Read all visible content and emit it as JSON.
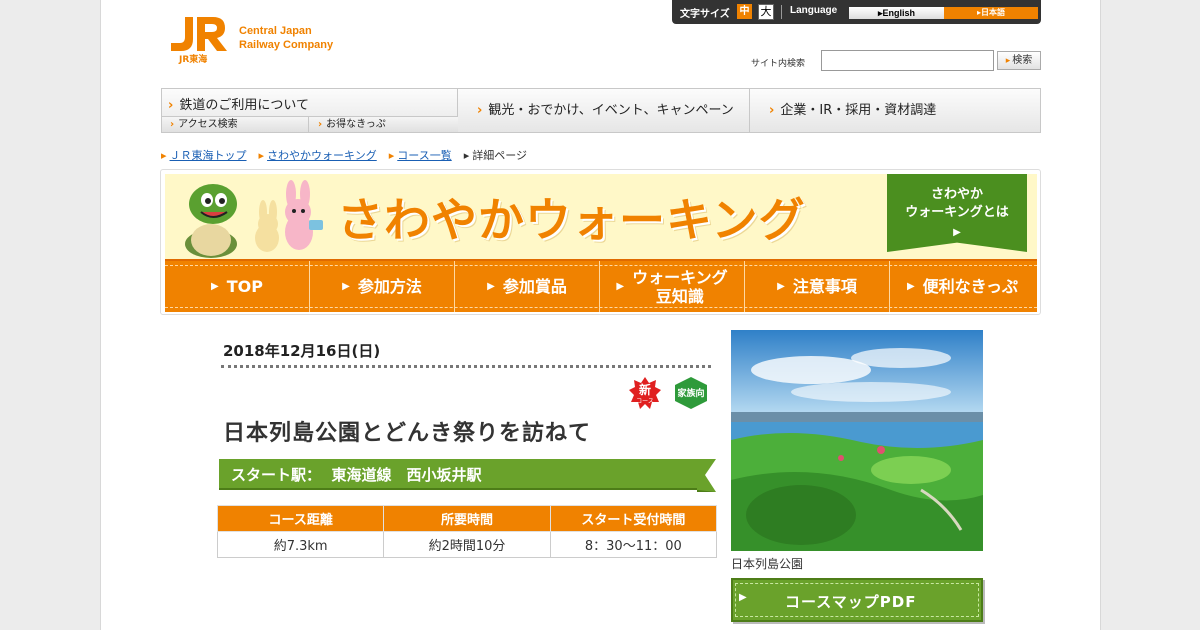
{
  "header": {
    "logo_mark": "JR",
    "logo_sub": "JR東海",
    "logo_line1": "Central Japan",
    "logo_line2": "Railway Company",
    "font_size_label": "文字サイズ",
    "font_mid": "中",
    "font_large": "大",
    "language_label": "Language",
    "lang_english": "English",
    "lang_japanese": "日本語",
    "search_label": "サイト内検索",
    "search_value": "",
    "search_button": "検索"
  },
  "gnav": {
    "railway": "鉄道のご利用について",
    "access": "アクセス検索",
    "tickets": "お得なきっぷ",
    "tourism": "観光・おでかけ、イベント、キャンペーン",
    "corporate": "企業・IR・採用・資材調達"
  },
  "breadcrumb": [
    "ＪＲ東海トップ",
    "さわやかウォーキング",
    "コース一覧",
    "詳細ページ"
  ],
  "banner": {
    "title": "さわやかウォーキング",
    "about_line1": "さわやか",
    "about_line2": "ウォーキングとは",
    "nav": [
      "TOP",
      "参加方法",
      "参加賞品",
      "ウォーキング豆知識",
      "注意事項",
      "便利なきっぷ"
    ],
    "nav_line2": {
      "index": 3,
      "line1": "ウォーキング",
      "line2": "豆知識"
    }
  },
  "course": {
    "date": "2018年12月16日(日)",
    "badge_new": "新",
    "badge_new_sub": "コース",
    "badge_family": "家族向",
    "title": "日本列島公園とどんき祭りを訪ねて",
    "start_label": "スタート駅：",
    "start_value": "東海道線　西小坂井駅",
    "table_headers": [
      "コース距離",
      "所要時間",
      "スタート受付時間"
    ],
    "table_values": [
      "約7.3km",
      "約2時間10分",
      "8：30～11：00"
    ]
  },
  "sidebar": {
    "photo_caption": "日本列島公園",
    "pdf_button": "コースマップPDF"
  },
  "colors": {
    "orange": "#f08200",
    "green": "#6aa22b",
    "dark_green": "#4b8f1f",
    "cream": "#fff8c8"
  }
}
